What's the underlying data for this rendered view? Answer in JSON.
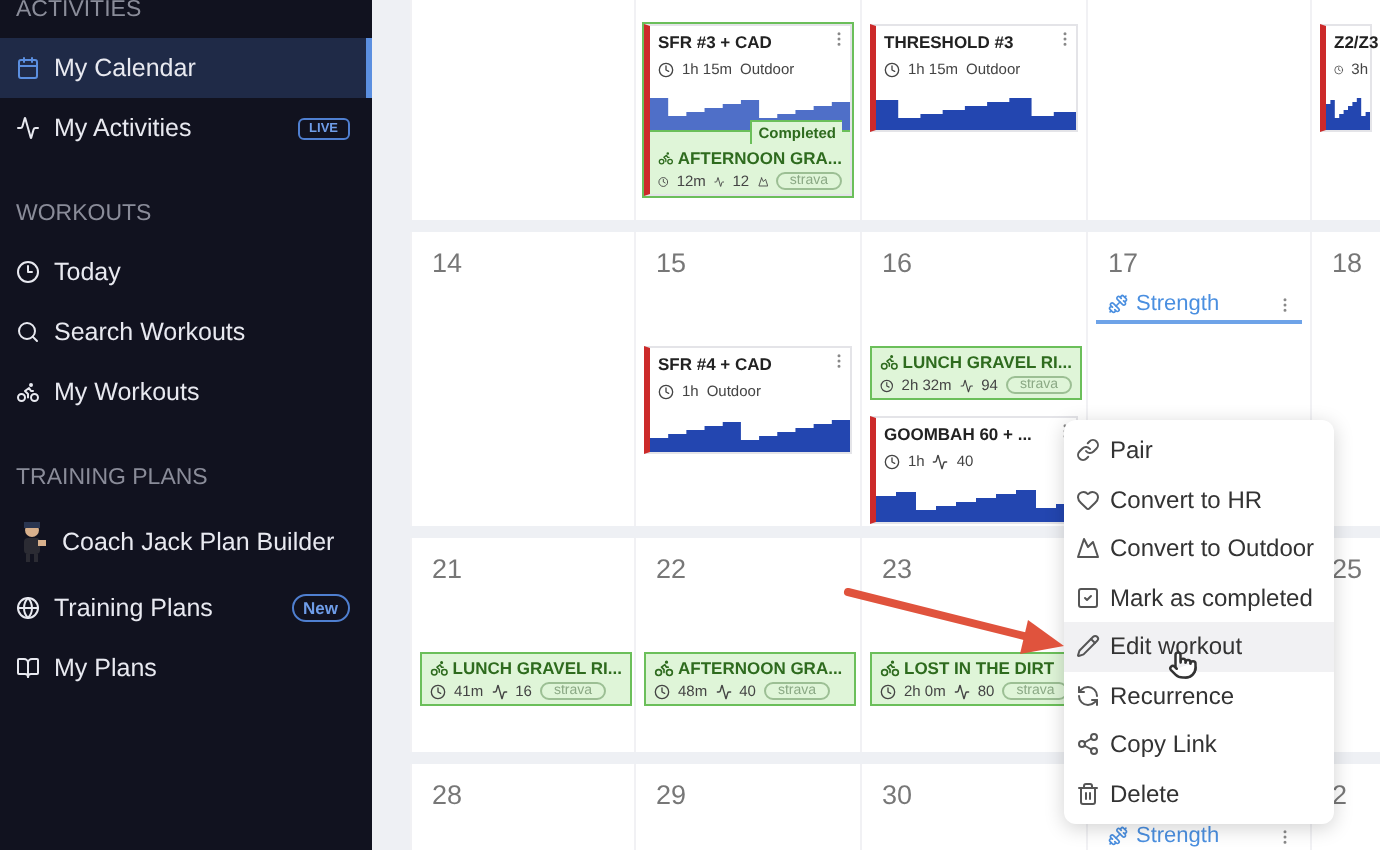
{
  "sidebar": {
    "sections": [
      {
        "title": "ACTIVITIES",
        "items": [
          {
            "kind": "calendar",
            "label": "My Calendar",
            "selected": true
          },
          {
            "kind": "activity",
            "label": "My Activities",
            "selected": false,
            "badge": "LIVE"
          }
        ]
      },
      {
        "title": "WORKOUTS",
        "items": [
          {
            "kind": "today",
            "label": "Today",
            "selected": false
          },
          {
            "kind": "search",
            "label": "Search Workouts",
            "selected": false
          },
          {
            "kind": "bike",
            "label": "My Workouts",
            "selected": false
          }
        ]
      },
      {
        "title": "TRAINING PLANS",
        "items": [
          {
            "kind": "coach",
            "label": "Coach Jack Plan Builder",
            "selected": false
          },
          {
            "kind": "globe",
            "label": "Training Plans",
            "selected": false,
            "badge": "New"
          },
          {
            "kind": "book",
            "label": "My Plans",
            "selected": false
          }
        ]
      }
    ]
  },
  "calendar": {
    "weeks": [
      {
        "days": [
          {
            "kind": "day"
          },
          {
            "events": [
              {
                "kind": "workout",
                "title": "SFR #3 + CAD",
                "duration": "1h 15m",
                "detail": "Outdoor",
                "completed": {
                  "label": "Completed",
                  "title": "AFTERNOON GRA...",
                  "duration": "12m",
                  "load": "12",
                  "source": "strava"
                }
              }
            ]
          },
          {
            "events": [
              {
                "kind": "workout",
                "title": "THRESHOLD #3",
                "duration": "1h 15m",
                "detail": "Outdoor"
              }
            ]
          },
          {
            "kind": "day"
          },
          {
            "events": [
              {
                "kind": "workout",
                "title": "Z2/Z3",
                "duration": "3h"
              }
            ]
          }
        ]
      },
      {
        "days": [
          {
            "date": "14"
          },
          {
            "date": "15",
            "events": [
              {
                "kind": "workout",
                "title": "SFR #4 + CAD",
                "duration": "1h",
                "detail": "Outdoor"
              }
            ]
          },
          {
            "date": "16",
            "events": [
              {
                "kind": "activity",
                "title": "LUNCH GRAVEL RI...",
                "duration": "2h 32m",
                "load": "94",
                "source": "strava"
              },
              {
                "kind": "workout",
                "title": "GOOMBAH 60 + ...",
                "duration": "1h",
                "load": "40"
              }
            ]
          },
          {
            "date": "17",
            "events": [
              {
                "kind": "strength",
                "title": "Strength"
              }
            ]
          },
          {
            "date": "18"
          }
        ]
      },
      {
        "days": [
          {
            "date": "21",
            "events": [
              {
                "kind": "activity",
                "title": "LUNCH GRAVEL RI...",
                "duration": "41m",
                "load": "16",
                "source": "strava"
              }
            ]
          },
          {
            "date": "22",
            "events": [
              {
                "kind": "activity",
                "title": "AFTERNOON GRA...",
                "duration": "48m",
                "load": "40",
                "source": "strava"
              }
            ]
          },
          {
            "date": "23",
            "events": [
              {
                "kind": "activity",
                "title": "LOST IN THE DIRT",
                "duration": "2h 0m",
                "load": "80",
                "source": "strava"
              }
            ]
          },
          {
            "kind": "covered"
          },
          {
            "date": "25"
          }
        ]
      },
      {
        "days": [
          {
            "date": "28"
          },
          {
            "date": "29"
          },
          {
            "date": "30"
          },
          {
            "events": [
              {
                "kind": "strength",
                "title": "Strength"
              }
            ]
          },
          {
            "date": "2"
          }
        ]
      }
    ]
  },
  "context_menu": {
    "items": [
      {
        "kind": "pair",
        "label": "Pair",
        "selected": false
      },
      {
        "kind": "hr",
        "label": "Convert to HR",
        "selected": false
      },
      {
        "kind": "outdoor",
        "label": "Convert to Outdoor",
        "selected": false
      },
      {
        "kind": "complete",
        "label": "Mark as completed",
        "selected": false
      },
      {
        "kind": "edit",
        "label": "Edit workout",
        "selected": true
      },
      {
        "kind": "recurrence",
        "label": "Recurrence",
        "selected": false
      },
      {
        "kind": "link",
        "label": "Copy Link",
        "selected": false
      },
      {
        "kind": "delete",
        "label": "Delete",
        "selected": false
      }
    ]
  }
}
